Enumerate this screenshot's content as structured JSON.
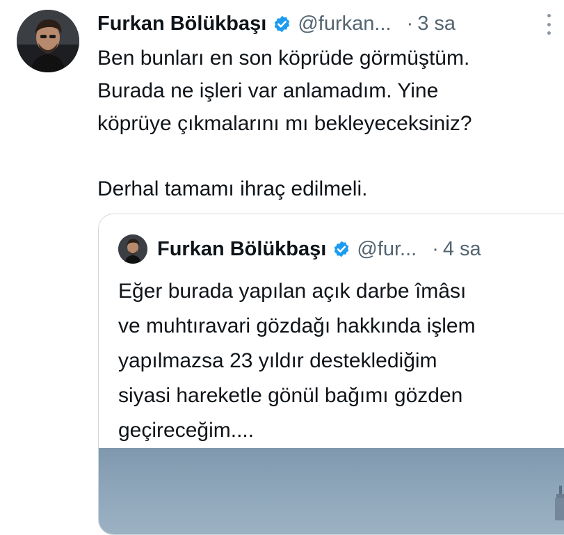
{
  "tweet": {
    "author_name": "Furkan Bölükbaşı",
    "handle": "@furkan...",
    "dot": "·",
    "time": "3 sa",
    "text": "Ben bunları en son köprüde görmüştüm.\nBurada ne işleri var anlamadım. Yine\nköprüye çıkmalarını mı bekleyeceksiniz?\n\nDerhal tamamı ihraç edilmeli.",
    "verified_color": "#1d9bf0",
    "more_icon": "more-vertical-icon"
  },
  "quoted_tweet": {
    "author_name": "Furkan Bölükbaşı",
    "handle": "@fur...",
    "dot": "·",
    "time": "4 sa",
    "text": "Eğer burada yapılan açık darbe îmâsı\nve muhtıravari gözdağı hakkında işlem\nyapılmazsa 23 yıldır desteklediğim\nsiyasi hareketle gönül bağımı gözden\ngeçireceğim....",
    "verified_color": "#1d9bf0"
  }
}
